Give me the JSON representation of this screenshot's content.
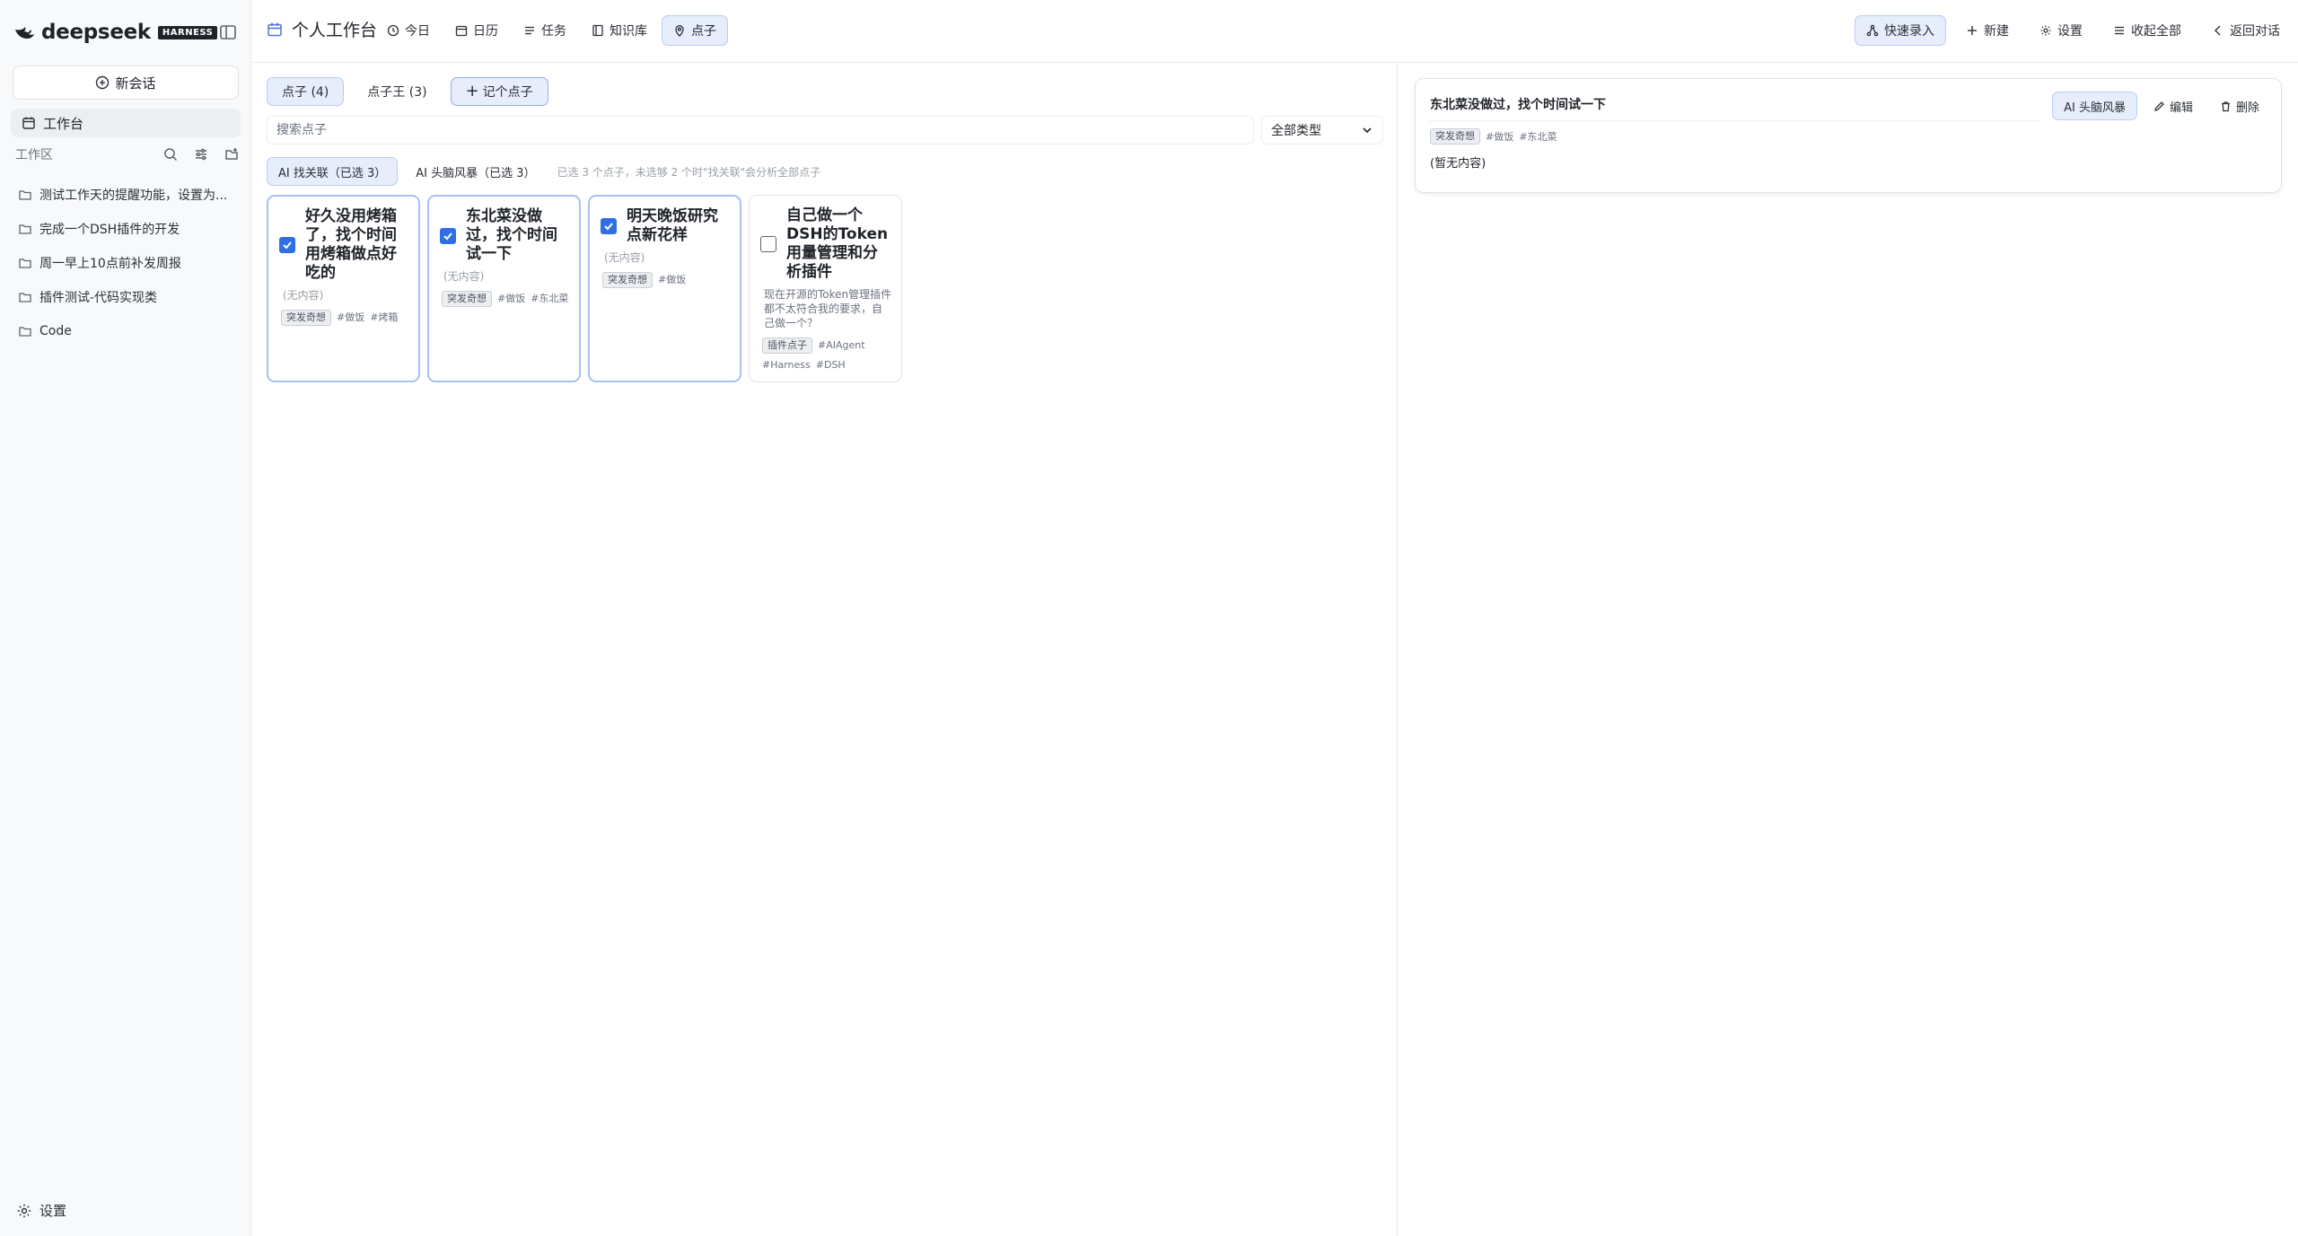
{
  "sidebar": {
    "brand": "deepseek",
    "badge": "HARNESS",
    "new_chat": "新会话",
    "workbench": "工作台",
    "workspace_label": "工作区",
    "items": [
      {
        "label": "测试工作天的提醒功能，设置为..."
      },
      {
        "label": "完成一个DSH插件的开发"
      },
      {
        "label": "周一早上10点前补发周报"
      },
      {
        "label": "插件测试-代码实现类"
      },
      {
        "label": "Code"
      }
    ],
    "settings": "设置"
  },
  "topbar": {
    "title": "个人工作台",
    "tabs": [
      "今日",
      "日历",
      "任务",
      "知识库",
      "点子"
    ],
    "active_tab": "点子",
    "actions": [
      "快速录入",
      "新建",
      "设置",
      "收起全部",
      "返回对话"
    ]
  },
  "main": {
    "sub_tabs": [
      "点子 (4)",
      "点子王 (3)"
    ],
    "add_idea": "记个点子",
    "search_placeholder": "搜索点子",
    "type_filter": "全部类型",
    "ai_buttons": [
      "AI 找关联（已选 3）",
      "AI 头脑风暴（已选 3）"
    ],
    "ai_hint": "已选 3 个点子，未选够 2 个时\"找关联\"会分析全部点子",
    "cards": [
      {
        "title": "好久没用烤箱了，找个时间用烤箱做点好吃的",
        "desc": "(无内容)",
        "badge": "突发奇想",
        "tags": [
          "#做饭",
          "#烤箱"
        ],
        "checked": true
      },
      {
        "title": "东北菜没做过，找个时间试一下",
        "desc": "(无内容)",
        "badge": "突发奇想",
        "tags": [
          "#做饭",
          "#东北菜"
        ],
        "checked": true
      },
      {
        "title": "明天晚饭研究点新花样",
        "desc": "(无内容)",
        "badge": "突发奇想",
        "tags": [
          "#做饭"
        ],
        "checked": true
      },
      {
        "title": "自己做一个DSH的Token用量管理和分析插件",
        "desc": "现在开源的Token管理插件都不太符合我的要求，自己做一个？",
        "badge": "插件点子",
        "tags": [
          "#AIAgent",
          "#Harness",
          "#DSH"
        ],
        "checked": false
      }
    ]
  },
  "detail": {
    "title": "东北菜没做过，找个时间试一下",
    "actions": [
      "AI 头脑风暴",
      "编辑",
      "删除"
    ],
    "badge": "突发奇想",
    "tags": [
      "#做饭",
      "#东北菜"
    ],
    "body": "(暂无内容)"
  },
  "colors": {
    "accent": "#2f6fe4",
    "active_bg": "#e6edfb",
    "active_border": "#b9cdf5"
  }
}
